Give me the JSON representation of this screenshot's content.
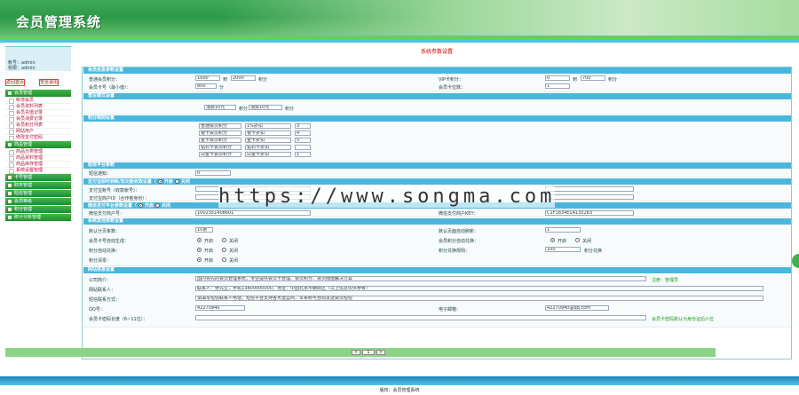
{
  "app": {
    "title": "会员管理系统"
  },
  "user": {
    "name_label": "帐号：",
    "name": "admin",
    "role_label": "权限：",
    "role": "admin"
  },
  "sidebar_buttons": {
    "home": "返回首页",
    "logout": "安全退出"
  },
  "menu": [
    {
      "header": "会员管理",
      "items": [
        "新增会员",
        "会员资料列表",
        "会员充值记录",
        "会员消费记录",
        "会员积分列表",
        "网站用户",
        "修改支付密码"
      ]
    },
    {
      "header": "商品管理",
      "items": [
        "商品分类管理",
        "商品资料管理",
        "商品库存管理",
        "系统设置管理"
      ]
    },
    {
      "header": "卡号管理",
      "items": []
    },
    {
      "header": "财务管理",
      "items": []
    },
    {
      "header": "短信管理",
      "items": []
    },
    {
      "header": "会员等级",
      "items": []
    },
    {
      "header": "积分管理",
      "items": []
    },
    {
      "header": "统计分析管理",
      "items": []
    }
  ],
  "page": {
    "title": "系统参数设置"
  },
  "sections": {
    "member": "会员信息参数设置",
    "mode": "营业模式设置",
    "rule": "积分规则设置",
    "sms": "短信平台参数",
    "pay1": "支付宝即时到帐/双功能收款设置（",
    "pay1_on": "开启",
    "pay1_off": "关闭",
    "pay2": "微信支付平台参数设置（",
    "pay2_on": "开启",
    "pay2_off": "关闭",
    "sys": "系统其他参数设置",
    "site": "网站信息设置"
  },
  "fields": {
    "m1_label": "普通会员积分：",
    "m1_a": "1000",
    "m1_b": "到",
    "m1_c": "2000",
    "m1_unit": "积分",
    "m2_label": "VIP卡积分：",
    "m2_a": "0",
    "m2_b": "到",
    "m2_c": "700",
    "m2_unit": "积分",
    "m3_label": "会员卡号（最小值）：",
    "m3_val": "800",
    "m3_unit": "分",
    "m4_label": "会员卡位数：",
    "m4_val": "1",
    "mode_a": "消费10元",
    "mode_b": "积分",
    "mode_c": "消费10元",
    "mode_d": "积分",
    "r1a": "普通会员积分",
    "r1b": "1%折扣",
    "r1c": "3",
    "r2a": "银卡会员积分",
    "r2b": "银卡折扣",
    "r2c": "4",
    "r3a": "金卡会员积分",
    "r3b": "金卡折扣",
    "r3c": "5",
    "r4a": "钻石卡会员积分",
    "r4b": "钻石卡折扣",
    "r4c": "",
    "r5a": "白金卡会员积分",
    "r5b": "白金卡折扣",
    "r5c": "1",
    "sms_label": "短信通知：",
    "sms_val": "0",
    "pay1_f1": "支付宝账号（收款帐号）：",
    "pay1_f2": "支付宝商户ID（合作者身份）：",
    "pay2_f1": "微信支付商户号：",
    "pay2_v1": "1002351408601",
    "pay2_f2": "微信支付商户KEY：",
    "pay2_v2": "C1F1834E1A135283",
    "s1_label": "默认分页条数：",
    "s1_val": "10条",
    "s1r": "默认页面自动刷新：",
    "s1r_val": "1",
    "s2_label": "会员卡号自动生成：",
    "s2_yes": "开启",
    "s2_no": "关闭",
    "s2r": "会员积分自动兑换：",
    "s2r_yes": "开启",
    "s2r_no": "关闭",
    "s3_label": "积分自动兑换：",
    "s3_yes": "开启",
    "s3_no": "关闭",
    "s3r": "积分兑换规则：",
    "s3r_val": "100",
    "s3r_unit": "积分兑换",
    "s4_label": "积分清零：",
    "s4_yes": "开启",
    "s4_no": "关闭",
    "w1_label": "公司简介：",
    "w1_val": "国内领先的会员管理系统，专业提供会员卡管理、会员积分、会员储值解决方案",
    "w1_note": "注册：管理员",
    "w2_label": "网站联系人：",
    "w2_val": "联系人：张先生，手机13800000000，地址：中国北京市朝阳区（以上信息仅供参考）",
    "w3_label": "短信联系方式：",
    "w3_val": "请填写短信联系人电话，短信平台支持各大运营商，本系统可自动发送会员短信",
    "w4_label": "QQ号：",
    "w4_val": "42270940",
    "w4r": "电子邮箱：",
    "w4r_val": "42270940@qq.com",
    "w5_label": "会员卡密码长度（6~11位）：",
    "w5_note": "会员卡密码默认为身份证后六位"
  },
  "pager": {
    "prev": "<",
    "page": "1",
    "next": ">"
  },
  "footer": {
    "copy": "版权：会员管理系统"
  },
  "watermark": "https://www.songma.com"
}
